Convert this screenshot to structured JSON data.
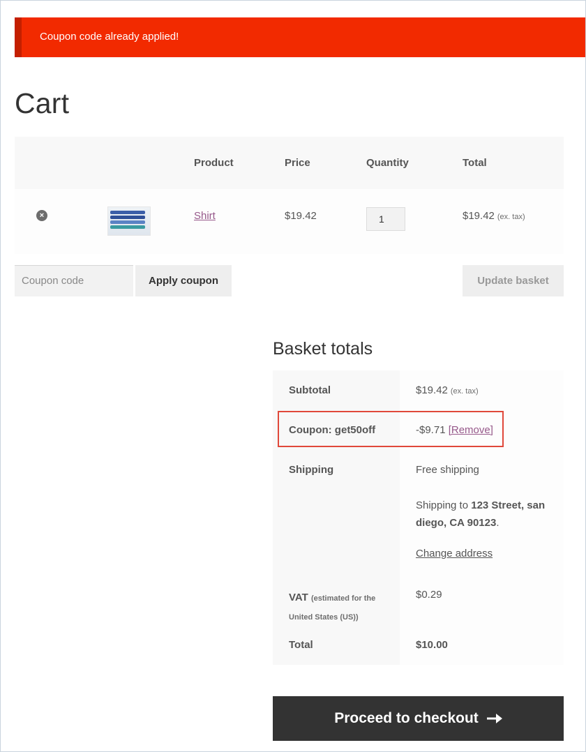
{
  "notice": {
    "message": "Coupon code already applied!"
  },
  "page_title": "Cart",
  "cart_table": {
    "headers": {
      "product": "Product",
      "price": "Price",
      "quantity": "Quantity",
      "total": "Total"
    },
    "items": [
      {
        "name": "Shirt",
        "price": "$19.42",
        "quantity": "1",
        "total": "$19.42",
        "total_note": "(ex. tax)",
        "remove_icon": "remove-circle-icon"
      }
    ]
  },
  "coupon": {
    "placeholder": "Coupon code",
    "apply_label": "Apply coupon"
  },
  "update_label": "Update basket",
  "totals": {
    "title": "Basket totals",
    "subtotal_label": "Subtotal",
    "subtotal_value": "$19.42",
    "subtotal_note": "(ex. tax)",
    "coupon_label": "Coupon: get50off",
    "coupon_value": "-$9.71",
    "coupon_remove": "[Remove]",
    "shipping_label": "Shipping",
    "shipping_method": "Free shipping",
    "shipping_to_prefix": "Shipping to",
    "shipping_address_line1": "123 Street, san",
    "shipping_address_line2": "diego, CA 90123",
    "shipping_to_suffix": ".",
    "change_address": "Change address",
    "vat_label": "VAT",
    "vat_note_line1": "(estimated for the",
    "vat_note_line2": "United States (US))",
    "vat_value": "$0.29",
    "total_label": "Total",
    "total_value": "$10.00"
  },
  "checkout": {
    "label": "Proceed to checkout",
    "icon": "arrow-right-icon"
  },
  "colors": {
    "notice": "#f22a00",
    "link": "#96588a",
    "checkout_bg": "#333333",
    "highlight": "#e0483a"
  }
}
